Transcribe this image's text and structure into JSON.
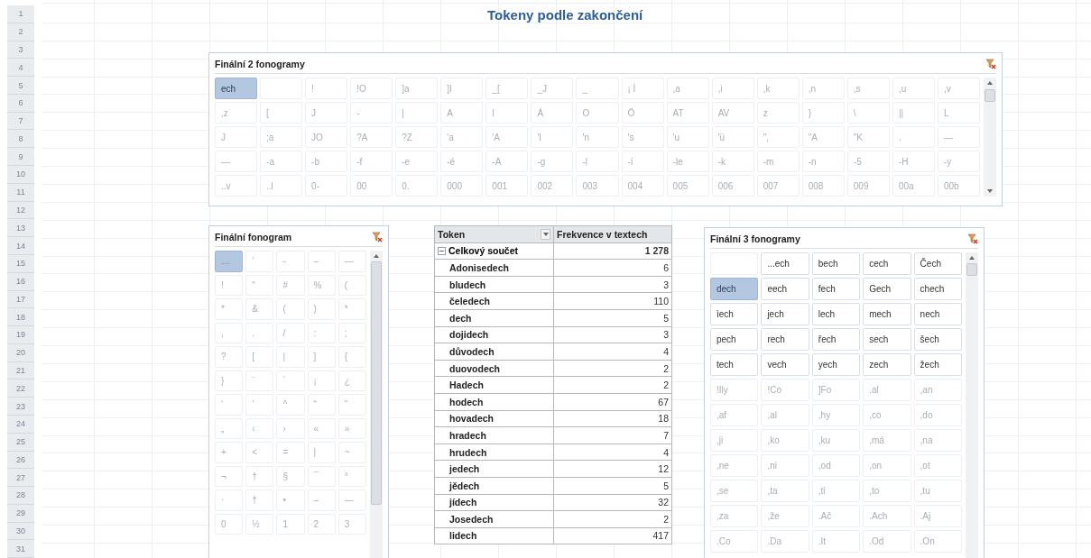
{
  "sheet": {
    "title": "Tokeny podle zakončení",
    "row_headers": [
      "1",
      "2",
      "3",
      "4",
      "5",
      "6",
      "7",
      "8",
      "9",
      "10",
      "11",
      "12",
      "13",
      "14",
      "15",
      "16",
      "17",
      "18",
      "19",
      "20",
      "21",
      "22",
      "23",
      "24",
      "25",
      "26",
      "27",
      "28",
      "29",
      "30",
      "31"
    ]
  },
  "slicers": [
    {
      "title": "Finální 2 fonogramy",
      "items": [
        {
          "text": "ech",
          "selected": true,
          "has_data": true
        },
        {
          "selected": false,
          "has_data": false
        },
        {
          "text": "!",
          "selected": false,
          "has_data": false
        },
        {
          "text": "!O",
          "selected": false,
          "has_data": false
        },
        {
          "text": "]a",
          "selected": false,
          "has_data": false
        },
        {
          "text": "]I",
          "selected": false,
          "has_data": false
        },
        {
          "text": "_[",
          "selected": false,
          "has_data": false
        },
        {
          "text": "_J",
          "selected": false,
          "has_data": false
        },
        {
          "text": "_",
          "selected": false,
          "has_data": false
        },
        {
          "text": "¡ Í",
          "selected": false,
          "has_data": false
        },
        {
          "text": ",a",
          "selected": false,
          "has_data": false
        },
        {
          "text": ",i",
          "selected": false,
          "has_data": false
        },
        {
          "text": ",k",
          "selected": false,
          "has_data": false
        },
        {
          "text": ",n",
          "selected": false,
          "has_data": false
        },
        {
          "text": ",s",
          "selected": false,
          "has_data": false
        },
        {
          "text": ",u",
          "selected": false,
          "has_data": false
        },
        {
          "text": ",v",
          "selected": false,
          "has_data": false
        },
        {
          "text": ",z",
          "selected": false,
          "has_data": false
        },
        {
          "text": "[",
          "selected": false,
          "has_data": false
        },
        {
          "text": "J",
          "selected": false,
          "has_data": false
        },
        {
          "text": "-",
          "selected": false,
          "has_data": false
        },
        {
          "text": "|",
          "selected": false,
          "has_data": false
        },
        {
          "text": "A",
          "selected": false,
          "has_data": false
        },
        {
          "text": "I",
          "selected": false,
          "has_data": false
        },
        {
          "text": "Á",
          "selected": false,
          "has_data": false
        },
        {
          "text": "O",
          "selected": false,
          "has_data": false
        },
        {
          "text": "Ö",
          "selected": false,
          "has_data": false
        },
        {
          "text": "AT",
          "selected": false,
          "has_data": false
        },
        {
          "text": "AV",
          "selected": false,
          "has_data": false
        },
        {
          "text": "z",
          "selected": false,
          "has_data": false
        },
        {
          "text": "}",
          "selected": false,
          "has_data": false
        },
        {
          "text": "\\",
          "selected": false,
          "has_data": false
        },
        {
          "text": "||",
          "selected": false,
          "has_data": false
        },
        {
          "text": "L",
          "selected": false,
          "has_data": false
        },
        {
          "text": "J",
          "selected": false,
          "has_data": false
        },
        {
          "text": ";a",
          "selected": false,
          "has_data": false
        },
        {
          "text": "JO",
          "selected": false,
          "has_data": false
        },
        {
          "text": "?A",
          "selected": false,
          "has_data": false
        },
        {
          "text": "?Z",
          "selected": false,
          "has_data": false
        },
        {
          "text": "'a",
          "selected": false,
          "has_data": false
        },
        {
          "text": "'A",
          "selected": false,
          "has_data": false
        },
        {
          "text": "'I",
          "selected": false,
          "has_data": false
        },
        {
          "text": "'n",
          "selected": false,
          "has_data": false
        },
        {
          "text": "'s",
          "selected": false,
          "has_data": false
        },
        {
          "text": "'u",
          "selected": false,
          "has_data": false
        },
        {
          "text": "'ü",
          "selected": false,
          "has_data": false
        },
        {
          "text": "\",",
          "selected": false,
          "has_data": false
        },
        {
          "text": "\"A",
          "selected": false,
          "has_data": false
        },
        {
          "text": "\"K",
          "selected": false,
          "has_data": false
        },
        {
          "text": ".",
          "selected": false,
          "has_data": false
        },
        {
          "text": "—",
          "selected": false,
          "has_data": false
        },
        {
          "text": "—",
          "selected": false,
          "has_data": false
        },
        {
          "text": "-a",
          "selected": false,
          "has_data": false
        },
        {
          "text": "-b",
          "selected": false,
          "has_data": false
        },
        {
          "text": "-f",
          "selected": false,
          "has_data": false
        },
        {
          "text": "-e",
          "selected": false,
          "has_data": false
        },
        {
          "text": "-é",
          "selected": false,
          "has_data": false
        },
        {
          "text": "-A",
          "selected": false,
          "has_data": false
        },
        {
          "text": "-g",
          "selected": false,
          "has_data": false
        },
        {
          "text": "-l",
          "selected": false,
          "has_data": false
        },
        {
          "text": "-í",
          "selected": false,
          "has_data": false
        },
        {
          "text": "-le",
          "selected": false,
          "has_data": false
        },
        {
          "text": "-k",
          "selected": false,
          "has_data": false
        },
        {
          "text": "-m",
          "selected": false,
          "has_data": false
        },
        {
          "text": "-n",
          "selected": false,
          "has_data": false
        },
        {
          "text": "-5",
          "selected": false,
          "has_data": false
        },
        {
          "text": "-H",
          "selected": false,
          "has_data": false
        },
        {
          "text": "-y",
          "selected": false,
          "has_data": false
        },
        {
          "text": "..v",
          "selected": false,
          "has_data": false
        },
        {
          "text": "..l",
          "selected": false,
          "has_data": false
        },
        {
          "text": "0-",
          "selected": false,
          "has_data": false
        },
        {
          "text": "00",
          "selected": false,
          "has_data": false
        },
        {
          "text": "0.",
          "selected": false,
          "has_data": false
        },
        {
          "text": "000",
          "selected": false,
          "has_data": false
        },
        {
          "text": "001",
          "selected": false,
          "has_data": false
        },
        {
          "text": "002",
          "selected": false,
          "has_data": false
        },
        {
          "text": "003",
          "selected": false,
          "has_data": false
        },
        {
          "text": "004",
          "selected": false,
          "has_data": false
        },
        {
          "text": "005",
          "selected": false,
          "has_data": false
        },
        {
          "text": "006",
          "selected": false,
          "has_data": false
        },
        {
          "text": "007",
          "selected": false,
          "has_data": false
        },
        {
          "text": "008",
          "selected": false,
          "has_data": false
        },
        {
          "text": "009",
          "selected": false,
          "has_data": false
        },
        {
          "text": "00a",
          "selected": false,
          "has_data": false
        },
        {
          "text": "00b",
          "selected": false,
          "has_data": false
        }
      ]
    },
    {
      "title": "Finální fonogram",
      "items": [
        {
          "text": "…",
          "selected": true,
          "has_data": false
        },
        {
          "text": "'",
          "selected": false,
          "has_data": false
        },
        {
          "text": "-",
          "selected": false,
          "has_data": false
        },
        {
          "text": "–",
          "selected": false,
          "has_data": false
        },
        {
          "text": "—",
          "selected": false,
          "has_data": false
        },
        {
          "text": "!",
          "selected": false,
          "has_data": false
        },
        {
          "text": "\"",
          "selected": false,
          "has_data": false
        },
        {
          "text": "#",
          "selected": false,
          "has_data": false
        },
        {
          "text": "%",
          "selected": false,
          "has_data": false
        },
        {
          "text": "(",
          "selected": false,
          "has_data": false
        },
        {
          "text": "*",
          "selected": false,
          "has_data": false
        },
        {
          "text": "&",
          "selected": false,
          "has_data": false
        },
        {
          "text": "(",
          "selected": false,
          "has_data": false
        },
        {
          "text": ")",
          "selected": false,
          "has_data": false
        },
        {
          "text": "*",
          "selected": false,
          "has_data": false
        },
        {
          "text": ",",
          "selected": false,
          "has_data": false
        },
        {
          "text": ".",
          "selected": false,
          "has_data": false
        },
        {
          "text": "/",
          "selected": false,
          "has_data": false
        },
        {
          "text": ":",
          "selected": false,
          "has_data": false
        },
        {
          "text": ";",
          "selected": false,
          "has_data": false
        },
        {
          "text": "?",
          "selected": false,
          "has_data": false
        },
        {
          "text": "[",
          "selected": false,
          "has_data": false
        },
        {
          "text": "|",
          "selected": false,
          "has_data": false
        },
        {
          "text": "]",
          "selected": false,
          "has_data": false
        },
        {
          "text": "{",
          "selected": false,
          "has_data": false
        },
        {
          "text": "}",
          "selected": false,
          "has_data": false
        },
        {
          "text": "¨",
          "selected": false,
          "has_data": false
        },
        {
          "text": "´",
          "selected": false,
          "has_data": false
        },
        {
          "text": "¡",
          "selected": false,
          "has_data": false
        },
        {
          "text": "¿",
          "selected": false,
          "has_data": false
        },
        {
          "text": "‘",
          "selected": false,
          "has_data": false
        },
        {
          "text": "’",
          "selected": false,
          "has_data": false
        },
        {
          "text": "^",
          "selected": false,
          "has_data": false
        },
        {
          "text": "“",
          "selected": false,
          "has_data": false
        },
        {
          "text": "”",
          "selected": false,
          "has_data": false
        },
        {
          "text": "„",
          "selected": false,
          "has_data": false
        },
        {
          "text": "‹",
          "selected": false,
          "has_data": false
        },
        {
          "text": "›",
          "selected": false,
          "has_data": false
        },
        {
          "text": "«",
          "selected": false,
          "has_data": false
        },
        {
          "text": "»",
          "selected": false,
          "has_data": false
        },
        {
          "text": "+",
          "selected": false,
          "has_data": false
        },
        {
          "text": "<",
          "selected": false,
          "has_data": false
        },
        {
          "text": "=",
          "selected": false,
          "has_data": false
        },
        {
          "text": "|",
          "selected": false,
          "has_data": false
        },
        {
          "text": "~",
          "selected": false,
          "has_data": false
        },
        {
          "text": "¬",
          "selected": false,
          "has_data": false
        },
        {
          "text": "†",
          "selected": false,
          "has_data": false
        },
        {
          "text": "§",
          "selected": false,
          "has_data": false
        },
        {
          "text": "¯",
          "selected": false,
          "has_data": false
        },
        {
          "text": "°",
          "selected": false,
          "has_data": false
        },
        {
          "text": "·",
          "selected": false,
          "has_data": false
        },
        {
          "text": "†",
          "selected": false,
          "has_data": false
        },
        {
          "text": "•",
          "selected": false,
          "has_data": false
        },
        {
          "text": "–",
          "selected": false,
          "has_data": false
        },
        {
          "text": "—",
          "selected": false,
          "has_data": false
        },
        {
          "text": "0",
          "selected": false,
          "has_data": false
        },
        {
          "text": "½",
          "selected": false,
          "has_data": false
        },
        {
          "text": "1",
          "selected": false,
          "has_data": false
        },
        {
          "text": "2",
          "selected": false,
          "has_data": false
        },
        {
          "text": "3",
          "selected": false,
          "has_data": false
        }
      ]
    },
    {
      "title": "Finální 3 fonogramy",
      "items": [
        {
          "selected": false,
          "has_data": false
        },
        {
          "text": "...ech",
          "selected": false,
          "has_data": true
        },
        {
          "text": "bech",
          "selected": false,
          "has_data": true
        },
        {
          "text": "cech",
          "selected": false,
          "has_data": true
        },
        {
          "text": "Čech",
          "selected": false,
          "has_data": true
        },
        {
          "text": "dech",
          "selected": true,
          "has_data": true
        },
        {
          "text": "eech",
          "selected": false,
          "has_data": true
        },
        {
          "text": "fech",
          "selected": false,
          "has_data": true
        },
        {
          "text": "Gech",
          "selected": false,
          "has_data": true
        },
        {
          "text": "chech",
          "selected": false,
          "has_data": true
        },
        {
          "text": "ìech",
          "selected": false,
          "has_data": true
        },
        {
          "text": "jech",
          "selected": false,
          "has_data": true
        },
        {
          "text": "lech",
          "selected": false,
          "has_data": true
        },
        {
          "text": "mech",
          "selected": false,
          "has_data": true
        },
        {
          "text": "nech",
          "selected": false,
          "has_data": true
        },
        {
          "text": "pech",
          "selected": false,
          "has_data": true
        },
        {
          "text": "rech",
          "selected": false,
          "has_data": true
        },
        {
          "text": "řech",
          "selected": false,
          "has_data": true
        },
        {
          "text": "sech",
          "selected": false,
          "has_data": true
        },
        {
          "text": "šech",
          "selected": false,
          "has_data": true
        },
        {
          "text": "tech",
          "selected": false,
          "has_data": true
        },
        {
          "text": "vech",
          "selected": false,
          "has_data": true
        },
        {
          "text": "yech",
          "selected": false,
          "has_data": true
        },
        {
          "text": "zech",
          "selected": false,
          "has_data": true
        },
        {
          "text": "žech",
          "selected": false,
          "has_data": true
        },
        {
          "text": "!Ily",
          "selected": false,
          "has_data": false
        },
        {
          "text": "!Co",
          "selected": false,
          "has_data": false
        },
        {
          "text": "]Fo",
          "selected": false,
          "has_data": false
        },
        {
          "text": ".al",
          "selected": false,
          "has_data": false
        },
        {
          "text": ",an",
          "selected": false,
          "has_data": false
        },
        {
          "text": ",af",
          "selected": false,
          "has_data": false
        },
        {
          "text": ",al",
          "selected": false,
          "has_data": false
        },
        {
          "text": ",hy",
          "selected": false,
          "has_data": false
        },
        {
          "text": ",co",
          "selected": false,
          "has_data": false
        },
        {
          "text": ",do",
          "selected": false,
          "has_data": false
        },
        {
          "text": ",ji",
          "selected": false,
          "has_data": false
        },
        {
          "text": ",ko",
          "selected": false,
          "has_data": false
        },
        {
          "text": ",ku",
          "selected": false,
          "has_data": false
        },
        {
          "text": ",má",
          "selected": false,
          "has_data": false
        },
        {
          "text": ",na",
          "selected": false,
          "has_data": false
        },
        {
          "text": ",ne",
          "selected": false,
          "has_data": false
        },
        {
          "text": ",ni",
          "selected": false,
          "has_data": false
        },
        {
          "text": ",od",
          "selected": false,
          "has_data": false
        },
        {
          "text": ",on",
          "selected": false,
          "has_data": false
        },
        {
          "text": ",ot",
          "selected": false,
          "has_data": false
        },
        {
          "text": ",se",
          "selected": false,
          "has_data": false
        },
        {
          "text": ",ta",
          "selected": false,
          "has_data": false
        },
        {
          "text": ",ti",
          "selected": false,
          "has_data": false
        },
        {
          "text": ",to",
          "selected": false,
          "has_data": false
        },
        {
          "text": ",tu",
          "selected": false,
          "has_data": false
        },
        {
          "text": ",za",
          "selected": false,
          "has_data": false
        },
        {
          "text": ",že",
          "selected": false,
          "has_data": false
        },
        {
          "text": ".Ač",
          "selected": false,
          "has_data": false
        },
        {
          "text": ".Ach",
          "selected": false,
          "has_data": false
        },
        {
          "text": ".Aj",
          "selected": false,
          "has_data": false
        },
        {
          "text": ".Co",
          "selected": false,
          "has_data": false
        },
        {
          "text": ".Da",
          "selected": false,
          "has_data": false
        },
        {
          "text": ".It",
          "selected": false,
          "has_data": false
        },
        {
          "text": ".Od",
          "selected": false,
          "has_data": false
        },
        {
          "text": ".On",
          "selected": false,
          "has_data": false
        }
      ]
    }
  ],
  "pivot": {
    "columns": [
      "Token",
      "Frekvence v textech"
    ],
    "total": {
      "label": "Celkový součet",
      "value": "1 278",
      "expanded": true
    },
    "rows": [
      {
        "token": "Adonisedech",
        "value": "6"
      },
      {
        "token": "bludech",
        "value": "3"
      },
      {
        "token": "čeledech",
        "value": "110"
      },
      {
        "token": "dech",
        "value": "5"
      },
      {
        "token": "dojidech",
        "value": "3"
      },
      {
        "token": "důvodech",
        "value": "4"
      },
      {
        "token": "duovodech",
        "value": "2"
      },
      {
        "token": "Hadech",
        "value": "2"
      },
      {
        "token": "hodech",
        "value": "67"
      },
      {
        "token": "hovadech",
        "value": "18"
      },
      {
        "token": "hradech",
        "value": "7"
      },
      {
        "token": "hrudech",
        "value": "4"
      },
      {
        "token": "jedech",
        "value": "12"
      },
      {
        "token": "jědech",
        "value": "5"
      },
      {
        "token": "jídech",
        "value": "32"
      },
      {
        "token": "Josedech",
        "value": "2"
      },
      {
        "token": "lidech",
        "value": "417"
      }
    ]
  }
}
